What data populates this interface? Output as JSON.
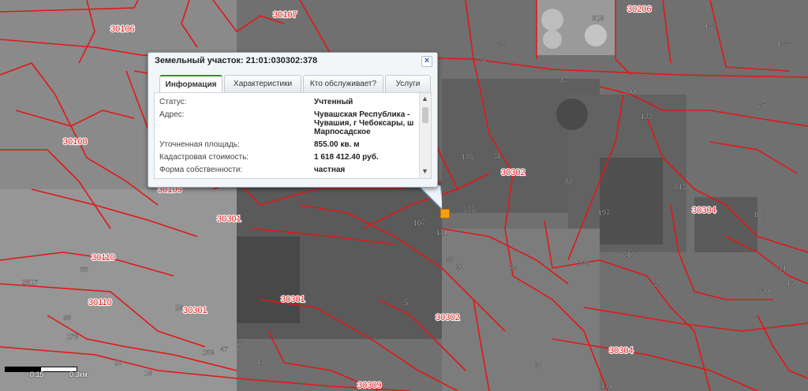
{
  "map": {
    "block_labels": [
      "30107",
      "30106",
      "30206",
      "30108",
      "30109",
      "30301",
      "30302",
      "30304",
      "30110",
      "30110",
      "30301",
      "30301",
      "30302",
      "30304",
      "30309"
    ],
    "parcel_labels": [
      "313",
      "132",
      "133",
      "92",
      "95",
      "87",
      "80",
      "45",
      "122",
      "126",
      "31",
      "613",
      "102",
      "197",
      "375",
      "107",
      "111",
      "82",
      "76",
      "20",
      "96",
      "5",
      "209",
      "616",
      "498",
      "221",
      "640",
      "140",
      "173",
      "98",
      "2817",
      "55",
      "29",
      "153",
      "47",
      "47",
      "11",
      "114",
      "19",
      "20",
      "30"
    ]
  },
  "popup": {
    "title": "Земельный участок: 21:01:030302:378",
    "close_icon": "close-icon",
    "tabs": [
      "Информация",
      "Характеристики",
      "Кто обслуживает?",
      "Услуги"
    ],
    "active_tab": "Информация",
    "rows": [
      {
        "label": "Статус:",
        "value": "Учтенный"
      },
      {
        "label": "Адрес:",
        "value": "Чувашская Республика - Чувашия, г Чебоксары, ш Марпосадское"
      },
      {
        "label": "Уточненная площадь:",
        "value": "855.00 кв. м"
      },
      {
        "label": "Кадастровая стоимость:",
        "value": "1 618 412.40 руб."
      },
      {
        "label": "Форма собственности:",
        "value": "частная"
      }
    ]
  },
  "scale": {
    "left_label": "0.15",
    "right_label": "0.3км"
  },
  "colors": {
    "parcel_border": "#e01818",
    "highlight": "#f2a20b",
    "active_tab_accent": "#3b8a2c"
  }
}
